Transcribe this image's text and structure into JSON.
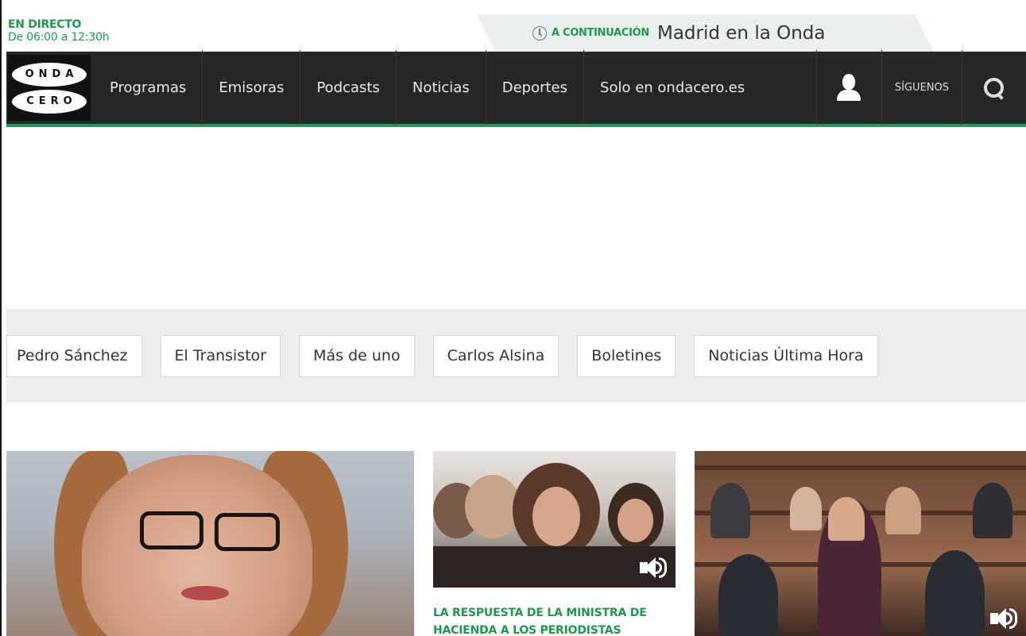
{
  "live": {
    "title": "EN DIRECTO",
    "time": "De 06:00 a 12:30h"
  },
  "next_up": {
    "label": "A CONTINUACIÓN",
    "program": "Madrid en la Onda"
  },
  "logo": {
    "line1": "ONDA",
    "line2": "CERO"
  },
  "nav": {
    "items": [
      {
        "label": "Programas"
      },
      {
        "label": "Emisoras"
      },
      {
        "label": "Podcasts"
      },
      {
        "label": "Noticias"
      },
      {
        "label": "Deportes"
      },
      {
        "label": "Solo en ondacero.es"
      }
    ],
    "follow_label": "SÍGUENOS"
  },
  "tags": [
    {
      "label": "Pedro Sánchez"
    },
    {
      "label": "El Transistor"
    },
    {
      "label": "Más de uno"
    },
    {
      "label": "Carlos Alsina"
    },
    {
      "label": "Boletines"
    },
    {
      "label": "Noticias Última Hora"
    }
  ],
  "news": {
    "headline_mid": "LA RESPUESTA DE LA MINISTRA DE HACIENDA A LOS PERIODISTAS"
  },
  "colors": {
    "accent": "#1a9a4a",
    "nav_bg": "#252726",
    "tags_bg": "#eceeed"
  },
  "icons": [
    "clock-icon",
    "user-icon",
    "search-icon",
    "audio-icon"
  ]
}
